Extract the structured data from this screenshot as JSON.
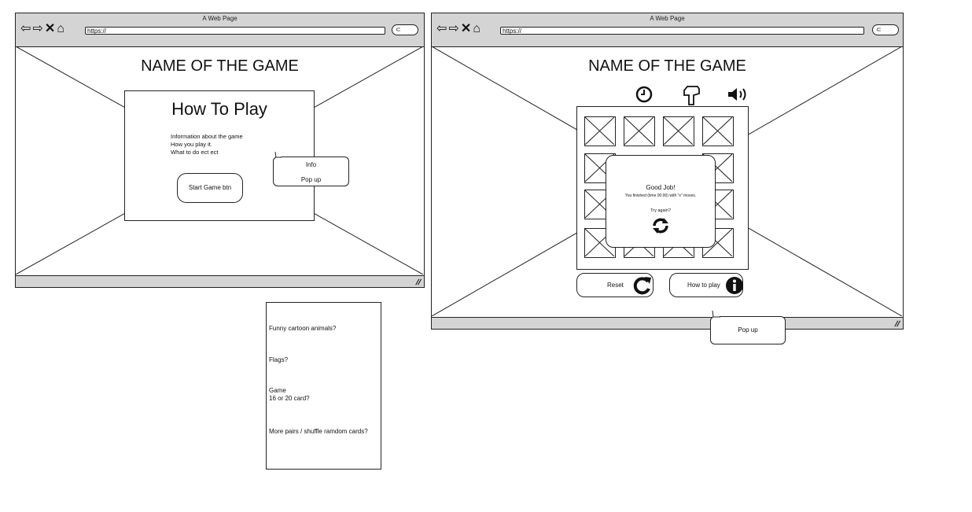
{
  "wireframe_left": {
    "window_title": "A Web Page",
    "url": "https://",
    "game_title": "NAME OF THE GAME",
    "how_to_play_title": "How To Play",
    "info_lines": [
      "Information about the game",
      "How you play it.",
      "What to do ect ect"
    ],
    "start_button": "Start Game btn",
    "callout_line1": "Info",
    "callout_line2": "Pop up"
  },
  "wireframe_right": {
    "window_title": "A Web Page",
    "url": "https://",
    "game_title": "NAME OF THE GAME",
    "icons": [
      "clock-icon",
      "pointing-hand-icon",
      "speaker-icon"
    ],
    "win_modal": {
      "title": "Good Job!",
      "message": "You finished (time 00:00) with \"x\" moves.",
      "retry_text": "Try again?"
    },
    "reset_button": "Reset",
    "how_to_play_button": "How to play",
    "callout": "Pop up"
  },
  "notes_card": {
    "item1": "Funny cartoon animals?",
    "item2": "Flags?",
    "item3": "Game\n16 or 20 card?",
    "item4": "More pairs / shuffle ramdom cards?"
  }
}
